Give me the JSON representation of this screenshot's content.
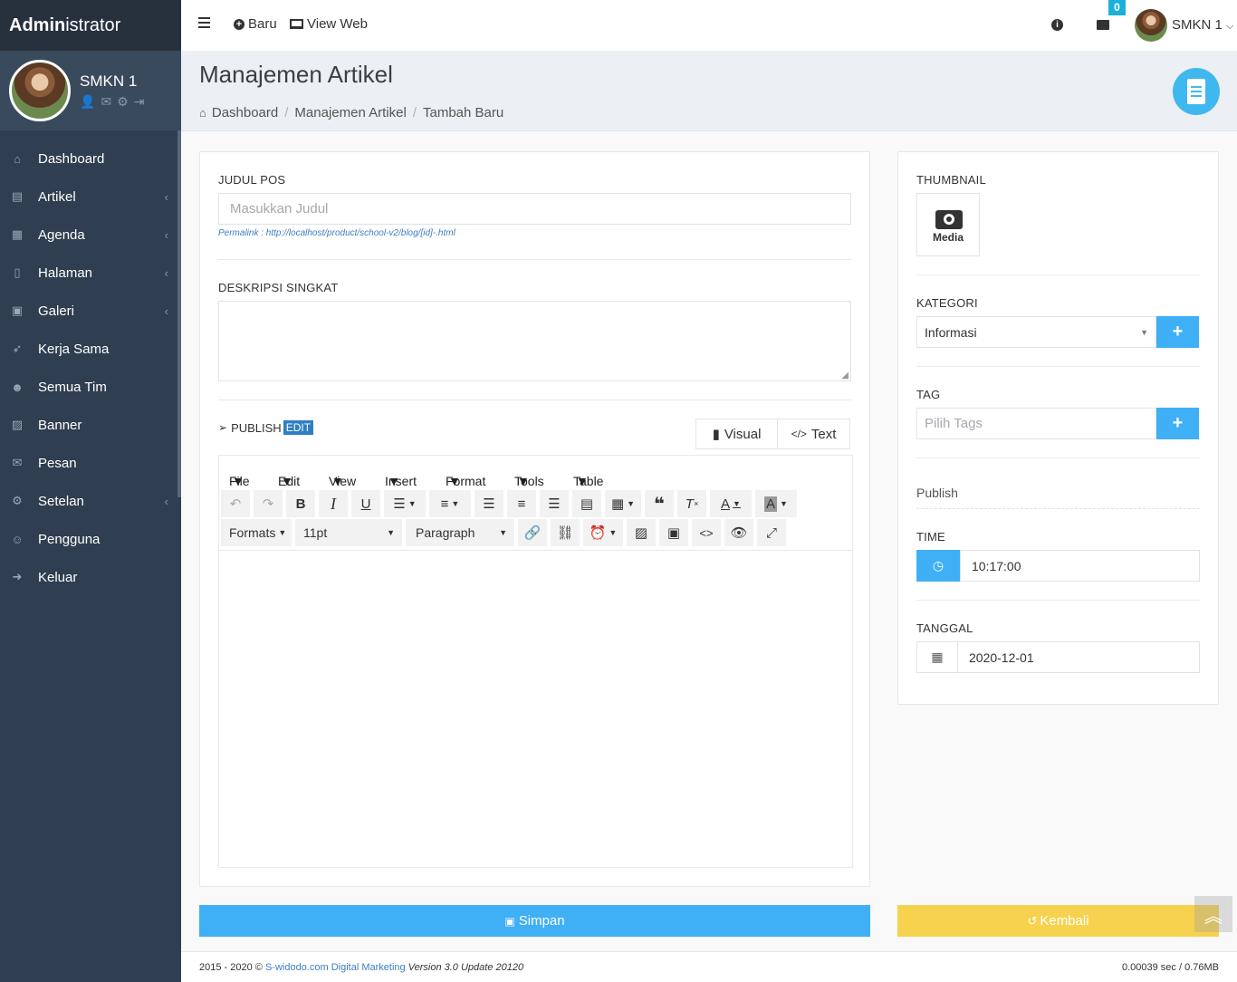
{
  "brand": {
    "bold": "Admin",
    "light": "istrator"
  },
  "profile": {
    "name": "SMKN 1"
  },
  "menu": [
    {
      "label": "Dashboard",
      "icon": "home-icon",
      "glyph": "⌂",
      "has_sub": false
    },
    {
      "label": "Artikel",
      "icon": "book-icon",
      "glyph": "▤",
      "has_sub": true
    },
    {
      "label": "Agenda",
      "icon": "calendar-icon",
      "glyph": "▦",
      "has_sub": true
    },
    {
      "label": "Halaman",
      "icon": "file-icon",
      "glyph": "▯",
      "has_sub": true
    },
    {
      "label": "Galeri",
      "icon": "gallery-icon",
      "glyph": "▣",
      "has_sub": true
    },
    {
      "label": "Kerja Sama",
      "icon": "rocket-icon",
      "glyph": "➶",
      "has_sub": false
    },
    {
      "label": "Semua Tim",
      "icon": "users-icon",
      "glyph": "☻",
      "has_sub": false
    },
    {
      "label": "Banner",
      "icon": "image-icon",
      "glyph": "▨",
      "has_sub": false
    },
    {
      "label": "Pesan",
      "icon": "envelope-icon",
      "glyph": "✉",
      "has_sub": false
    },
    {
      "label": "Setelan",
      "icon": "cogs-icon",
      "glyph": "⚙",
      "has_sub": true
    },
    {
      "label": "Pengguna",
      "icon": "group-icon",
      "glyph": "☺",
      "has_sub": false
    },
    {
      "label": "Keluar",
      "icon": "sign-out-icon",
      "glyph": "➜",
      "has_sub": false
    }
  ],
  "topbar": {
    "new_label": "Baru",
    "view_web_label": "View Web",
    "mail_count": "0",
    "user_name": "SMKN 1"
  },
  "page": {
    "title": "Manajemen Artikel",
    "breadcrumbs": [
      "Dashboard",
      "Manajemen Artikel",
      "Tambah Baru"
    ]
  },
  "form": {
    "title_label": "JUDUL POS",
    "title_placeholder": "Masukkan Judul",
    "permalink": "Permalink : http://localhost/product/school-v2/blog/[id]-.html",
    "desc_label": "DESKRIPSI SINGKAT",
    "publish_label": "PUBLISH",
    "edit_label": "EDIT",
    "visual_label": "Visual",
    "text_label": "Text"
  },
  "editor": {
    "menu": [
      "File",
      "Edit",
      "View",
      "Insert",
      "Format",
      "Tools",
      "Table"
    ],
    "formats_label": "Formats",
    "font_size": "11pt",
    "block": "Paragraph"
  },
  "sidebar_form": {
    "thumbnail_label": "THUMBNAIL",
    "media_label": "Media",
    "kategori_label": "KATEGORI",
    "kategori_value": "Informasi",
    "tag_label": "TAG",
    "tag_placeholder": "Pilih Tags",
    "publish_heading": "Publish",
    "time_label": "TIME",
    "time_value": "10:17:00",
    "date_label": "TANGGAL",
    "date_value": "2020-12-01"
  },
  "actions": {
    "save_label": "Simpan",
    "back_label": "Kembali"
  },
  "footer": {
    "copyright": "2015 - 2020 ©",
    "link": "S-widodo.com Digital Marketing",
    "version": "Version 3.0 Update 20120",
    "stats": "0.00039 sec / 0.76MB"
  }
}
